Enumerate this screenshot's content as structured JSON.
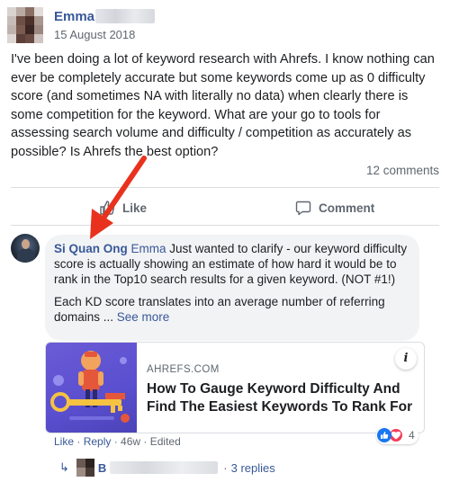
{
  "post": {
    "author": "Emma",
    "date": "15 August 2018",
    "text": "I've been doing a lot of keyword research with Ahrefs. I know nothing can ever be completely accurate but some keywords come up as 0 difficulty score (and sometimes NA with literally no data) when clearly there is some competition for the keyword. What are your go to tools for assessing search volume and difficulty / competition as accurately as possible? Is Ahrefs the best option?",
    "comments_count": "12 comments"
  },
  "actions": {
    "like_label": "Like",
    "comment_label": "Comment"
  },
  "comment": {
    "author": "Si Quan Ong",
    "mention": "Emma",
    "text1": " Just wanted to clarify - our keyword difficulty score is actually showing an estimate of how hard it would be to rank in the Top10 search results for a given keyword. (NOT #1!)",
    "text2": "Each KD score translates into an average number of referring domains ... ",
    "see_more": "See more"
  },
  "link_preview": {
    "site": "AHREFS.COM",
    "title": "How To Gauge Keyword Difficulty And Find The Easiest Keywords To Rank For",
    "info_label": "i"
  },
  "comment_meta": {
    "like": "Like",
    "reply": "Reply",
    "sep": " · ",
    "age": "46w",
    "edited": "Edited",
    "reaction_count": "4"
  },
  "replies": {
    "author_initial": "B",
    "dot": "·",
    "count_label": "3 replies"
  },
  "colors": {
    "link_blue": "#385898",
    "secondary_text": "#606770",
    "bubble_bg": "#f2f3f5",
    "annotation_arrow": "#e8321e"
  }
}
